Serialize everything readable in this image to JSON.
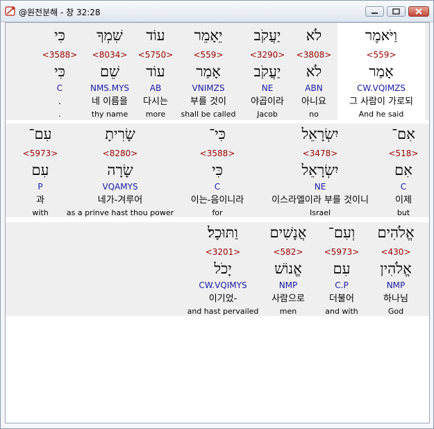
{
  "window": {
    "title": "@원전분해 - 창 32:28"
  },
  "rows": [
    [
      {
        "heb": "כִּי",
        "num": "<3588>",
        "root": "כִּי",
        "morph": "C",
        "kor": ".",
        "eng": "."
      },
      {
        "heb": "שִׁמְךָ",
        "num": "<8034>",
        "root": "שֵׁם",
        "morph": "NMS.MYS",
        "kor": "네 이름을",
        "eng": "thy name"
      },
      {
        "heb": "עוֹד",
        "num": "<5750>",
        "root": "עוֹד",
        "morph": "AB",
        "kor": "다시는",
        "eng": "more"
      },
      {
        "heb": "יֵאָמֵר",
        "num": "<559>",
        "root": "אָמַר",
        "morph": "VNIMZS",
        "kor": "부를 것이",
        "eng": "shall be called"
      },
      {
        "heb": "יַעֲקֹב",
        "num": "<3290>",
        "root": "יַעֲקֹב",
        "morph": "NE",
        "kor": "야곱이라",
        "eng": "Jacob"
      },
      {
        "heb": "לֹא",
        "num": "<3808>",
        "root": "לֹא",
        "morph": "ABN",
        "kor": "아니요",
        "eng": "no"
      },
      {
        "heb": "וַיֹּאמֶר",
        "num": "<559>",
        "root": "אָמַר",
        "morph": "CW.VQIMZS",
        "kor": "그 사람이 가로되",
        "eng": "And he said"
      }
    ],
    [
      {
        "heb": "עִם־",
        "num": "<5973>",
        "root": "עִם",
        "morph": "P",
        "kor": "과",
        "eng": "with"
      },
      {
        "heb": "שָׂרִיתָ",
        "num": "<8280>",
        "root": "שָׂרָה",
        "morph": "VQAMYS",
        "kor": "네가-겨루어",
        "eng": "as a prinve hast thou power"
      },
      {
        "heb": "כִּי־",
        "num": "<3588>",
        "root": "כִּי",
        "morph": "C",
        "kor": "이는-음이니라",
        "eng": "for"
      },
      {
        "heb": "יִשְׂרָאֵל",
        "num": "<3478>",
        "root": "יִשְׂרָאֵל",
        "morph": "NE",
        "kor": "이스라엘이라 부를 것이니",
        "eng": "Israel"
      },
      {
        "heb": "אִם־",
        "num": "<518>",
        "root": "אִם",
        "morph": "C",
        "kor": "이제",
        "eng": "but"
      }
    ],
    [
      {
        "heb": "וַתּוּכָל׃",
        "num": "<3201>",
        "root": "יָכֹל",
        "morph": "CW.VQIMYS",
        "kor": "이기었-",
        "eng": "and hast pervailed"
      },
      {
        "heb": "אֲנָשִׁים",
        "num": "<582>",
        "root": "אֱנוֹשׁ",
        "morph": "NMP",
        "kor": "사람으로",
        "eng": "men"
      },
      {
        "heb": "וְעִם־",
        "num": "<5973>",
        "root": "עִם",
        "morph": "C.P",
        "kor": "더불어",
        "eng": "and with"
      },
      {
        "heb": "אֱלֹהִים",
        "num": "<430>",
        "root": "אֱלֹהִין",
        "morph": "NMP",
        "kor": "하나님",
        "eng": "God"
      }
    ]
  ]
}
